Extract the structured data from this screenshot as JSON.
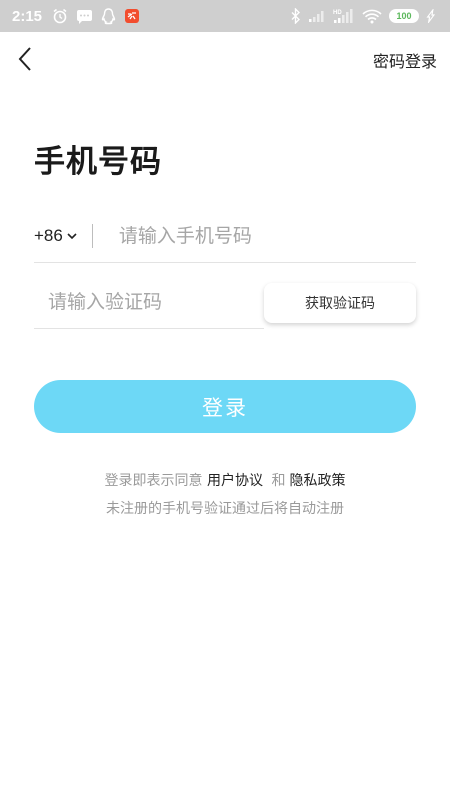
{
  "status_bar": {
    "time": "2:15",
    "battery": "100",
    "network": "HD"
  },
  "nav": {
    "password_login": "密码登录"
  },
  "title": "手机号码",
  "phone": {
    "country_code": "+86",
    "placeholder": "请输入手机号码"
  },
  "code": {
    "placeholder": "请输入验证码",
    "get_code_label": "获取验证码"
  },
  "login": {
    "label": "登录",
    "color": "#6dd8f6"
  },
  "agreement": {
    "prefix": "登录即表示同意",
    "user_agreement": "用户协议",
    "and": "和",
    "privacy_policy": "隐私政策",
    "hint": "未注册的手机号验证通过后将自动注册"
  }
}
